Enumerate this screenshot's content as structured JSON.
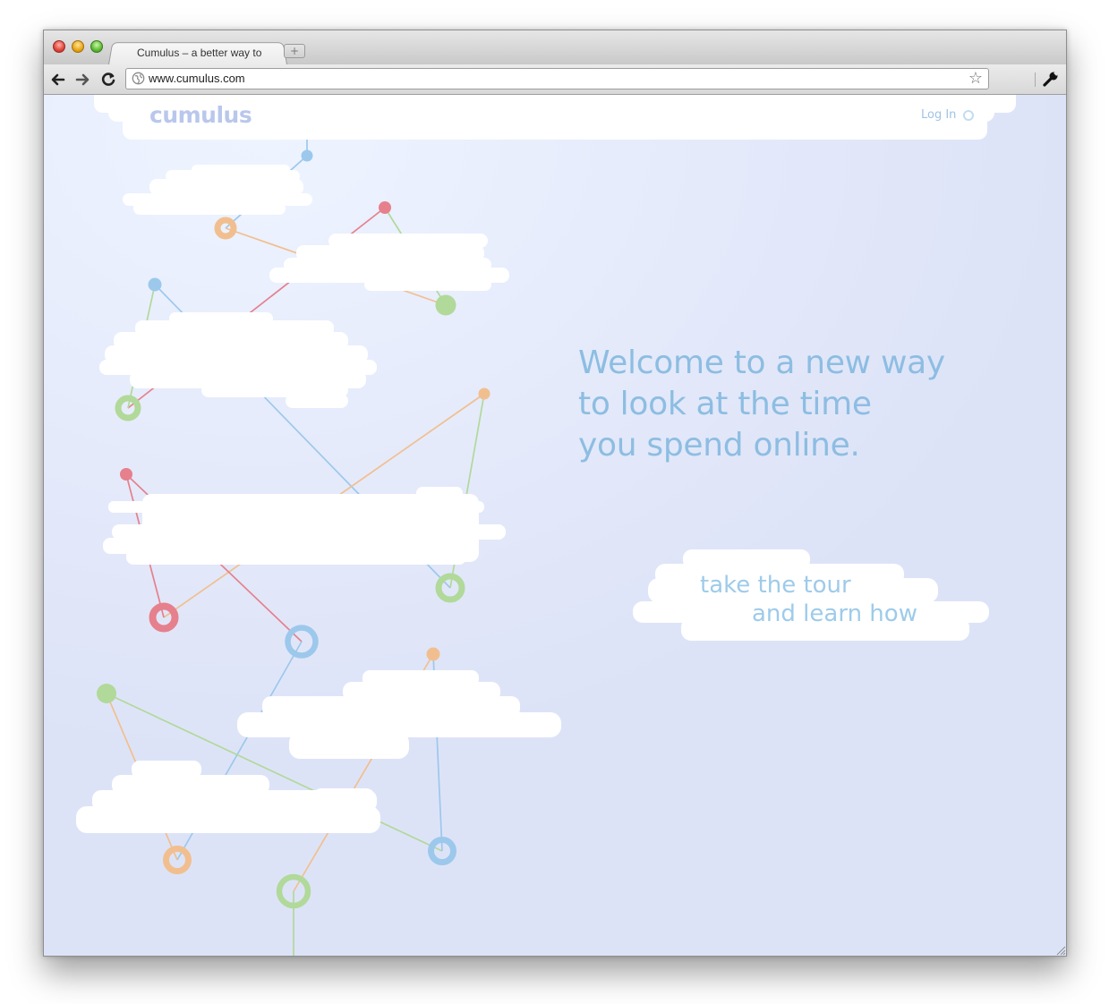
{
  "browser": {
    "tab_title": "Cumulus – a better way to",
    "new_tab_icon": "plus-icon",
    "url": "www.cumulus.com",
    "nav": [
      "back-arrow-icon",
      "forward-arrow-icon",
      "reload-icon"
    ],
    "bookmark_icon": "star-icon",
    "menu_icon": "wrench-icon"
  },
  "site": {
    "logo": "cumulus",
    "login_label": "Log In",
    "headline": [
      "Welcome to a new way",
      "to look at the time",
      "you spend online."
    ],
    "tour_line1": "take the tour",
    "tour_line2": "and learn how",
    "colors": {
      "blue": "#9cc8ec",
      "orange": "#f1bf8f",
      "red": "#e6808d",
      "green": "#b1d99a",
      "headline": "#8dbde2",
      "background": "#e3e7f7"
    }
  }
}
